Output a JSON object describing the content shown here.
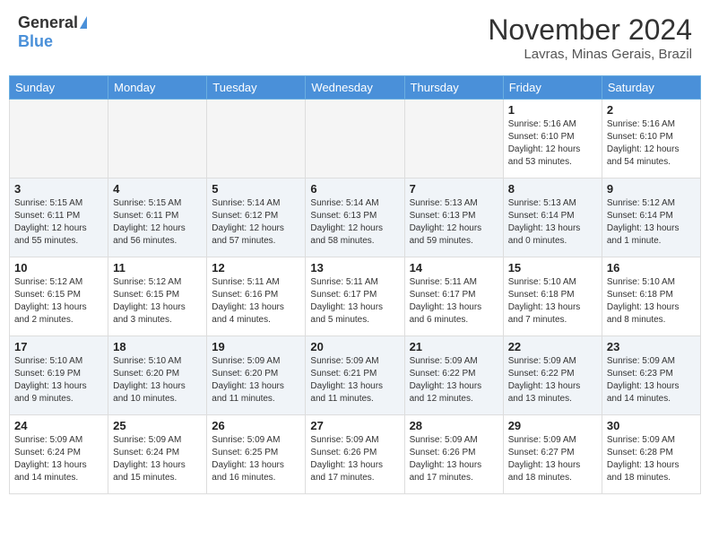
{
  "header": {
    "logo_general": "General",
    "logo_blue": "Blue",
    "month_title": "November 2024",
    "location": "Lavras, Minas Gerais, Brazil"
  },
  "days_of_week": [
    "Sunday",
    "Monday",
    "Tuesday",
    "Wednesday",
    "Thursday",
    "Friday",
    "Saturday"
  ],
  "weeks": [
    [
      {
        "day": "",
        "empty": true
      },
      {
        "day": "",
        "empty": true
      },
      {
        "day": "",
        "empty": true
      },
      {
        "day": "",
        "empty": true
      },
      {
        "day": "",
        "empty": true
      },
      {
        "day": "1",
        "sunrise": "5:16 AM",
        "sunset": "6:10 PM",
        "daylight": "12 hours and 53 minutes."
      },
      {
        "day": "2",
        "sunrise": "5:16 AM",
        "sunset": "6:10 PM",
        "daylight": "12 hours and 54 minutes."
      }
    ],
    [
      {
        "day": "3",
        "sunrise": "5:15 AM",
        "sunset": "6:11 PM",
        "daylight": "12 hours and 55 minutes."
      },
      {
        "day": "4",
        "sunrise": "5:15 AM",
        "sunset": "6:11 PM",
        "daylight": "12 hours and 56 minutes."
      },
      {
        "day": "5",
        "sunrise": "5:14 AM",
        "sunset": "6:12 PM",
        "daylight": "12 hours and 57 minutes."
      },
      {
        "day": "6",
        "sunrise": "5:14 AM",
        "sunset": "6:13 PM",
        "daylight": "12 hours and 58 minutes."
      },
      {
        "day": "7",
        "sunrise": "5:13 AM",
        "sunset": "6:13 PM",
        "daylight": "12 hours and 59 minutes."
      },
      {
        "day": "8",
        "sunrise": "5:13 AM",
        "sunset": "6:14 PM",
        "daylight": "13 hours and 0 minutes."
      },
      {
        "day": "9",
        "sunrise": "5:12 AM",
        "sunset": "6:14 PM",
        "daylight": "13 hours and 1 minute."
      }
    ],
    [
      {
        "day": "10",
        "sunrise": "5:12 AM",
        "sunset": "6:15 PM",
        "daylight": "13 hours and 2 minutes."
      },
      {
        "day": "11",
        "sunrise": "5:12 AM",
        "sunset": "6:15 PM",
        "daylight": "13 hours and 3 minutes."
      },
      {
        "day": "12",
        "sunrise": "5:11 AM",
        "sunset": "6:16 PM",
        "daylight": "13 hours and 4 minutes."
      },
      {
        "day": "13",
        "sunrise": "5:11 AM",
        "sunset": "6:17 PM",
        "daylight": "13 hours and 5 minutes."
      },
      {
        "day": "14",
        "sunrise": "5:11 AM",
        "sunset": "6:17 PM",
        "daylight": "13 hours and 6 minutes."
      },
      {
        "day": "15",
        "sunrise": "5:10 AM",
        "sunset": "6:18 PM",
        "daylight": "13 hours and 7 minutes."
      },
      {
        "day": "16",
        "sunrise": "5:10 AM",
        "sunset": "6:18 PM",
        "daylight": "13 hours and 8 minutes."
      }
    ],
    [
      {
        "day": "17",
        "sunrise": "5:10 AM",
        "sunset": "6:19 PM",
        "daylight": "13 hours and 9 minutes."
      },
      {
        "day": "18",
        "sunrise": "5:10 AM",
        "sunset": "6:20 PM",
        "daylight": "13 hours and 10 minutes."
      },
      {
        "day": "19",
        "sunrise": "5:09 AM",
        "sunset": "6:20 PM",
        "daylight": "13 hours and 11 minutes."
      },
      {
        "day": "20",
        "sunrise": "5:09 AM",
        "sunset": "6:21 PM",
        "daylight": "13 hours and 11 minutes."
      },
      {
        "day": "21",
        "sunrise": "5:09 AM",
        "sunset": "6:22 PM",
        "daylight": "13 hours and 12 minutes."
      },
      {
        "day": "22",
        "sunrise": "5:09 AM",
        "sunset": "6:22 PM",
        "daylight": "13 hours and 13 minutes."
      },
      {
        "day": "23",
        "sunrise": "5:09 AM",
        "sunset": "6:23 PM",
        "daylight": "13 hours and 14 minutes."
      }
    ],
    [
      {
        "day": "24",
        "sunrise": "5:09 AM",
        "sunset": "6:24 PM",
        "daylight": "13 hours and 14 minutes."
      },
      {
        "day": "25",
        "sunrise": "5:09 AM",
        "sunset": "6:24 PM",
        "daylight": "13 hours and 15 minutes."
      },
      {
        "day": "26",
        "sunrise": "5:09 AM",
        "sunset": "6:25 PM",
        "daylight": "13 hours and 16 minutes."
      },
      {
        "day": "27",
        "sunrise": "5:09 AM",
        "sunset": "6:26 PM",
        "daylight": "13 hours and 17 minutes."
      },
      {
        "day": "28",
        "sunrise": "5:09 AM",
        "sunset": "6:26 PM",
        "daylight": "13 hours and 17 minutes."
      },
      {
        "day": "29",
        "sunrise": "5:09 AM",
        "sunset": "6:27 PM",
        "daylight": "13 hours and 18 minutes."
      },
      {
        "day": "30",
        "sunrise": "5:09 AM",
        "sunset": "6:28 PM",
        "daylight": "13 hours and 18 minutes."
      }
    ]
  ],
  "labels": {
    "sunrise": "Sunrise:",
    "sunset": "Sunset:",
    "daylight": "Daylight:"
  }
}
